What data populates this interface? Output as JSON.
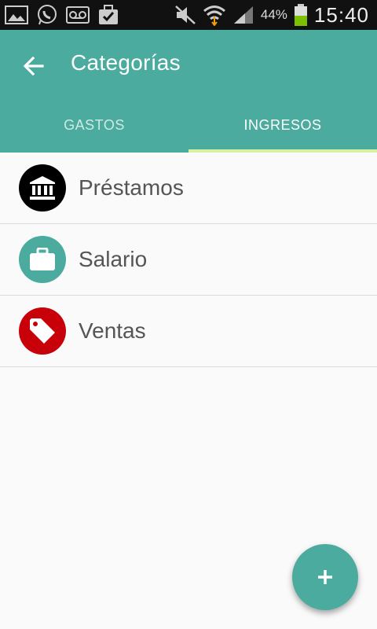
{
  "status_bar": {
    "battery_percent": "44%",
    "time": "15:40"
  },
  "app_bar": {
    "title": "Categorías"
  },
  "tabs": [
    {
      "label": "GASTOS",
      "active": false
    },
    {
      "label": "INGRESOS",
      "active": true
    }
  ],
  "categories": [
    {
      "label": "Préstamos",
      "icon": "bank-icon",
      "color": "#000000"
    },
    {
      "label": "Salario",
      "icon": "briefcase-icon",
      "color": "#4aab9e"
    },
    {
      "label": "Ventas",
      "icon": "tag-icon",
      "color": "#c8000a"
    }
  ],
  "fab": {
    "icon": "plus-icon",
    "label": "+"
  },
  "colors": {
    "primary": "#4aab9e",
    "tab_indicator": "#d8f0a4",
    "status_bar": "#111111",
    "background": "#fafafa"
  }
}
